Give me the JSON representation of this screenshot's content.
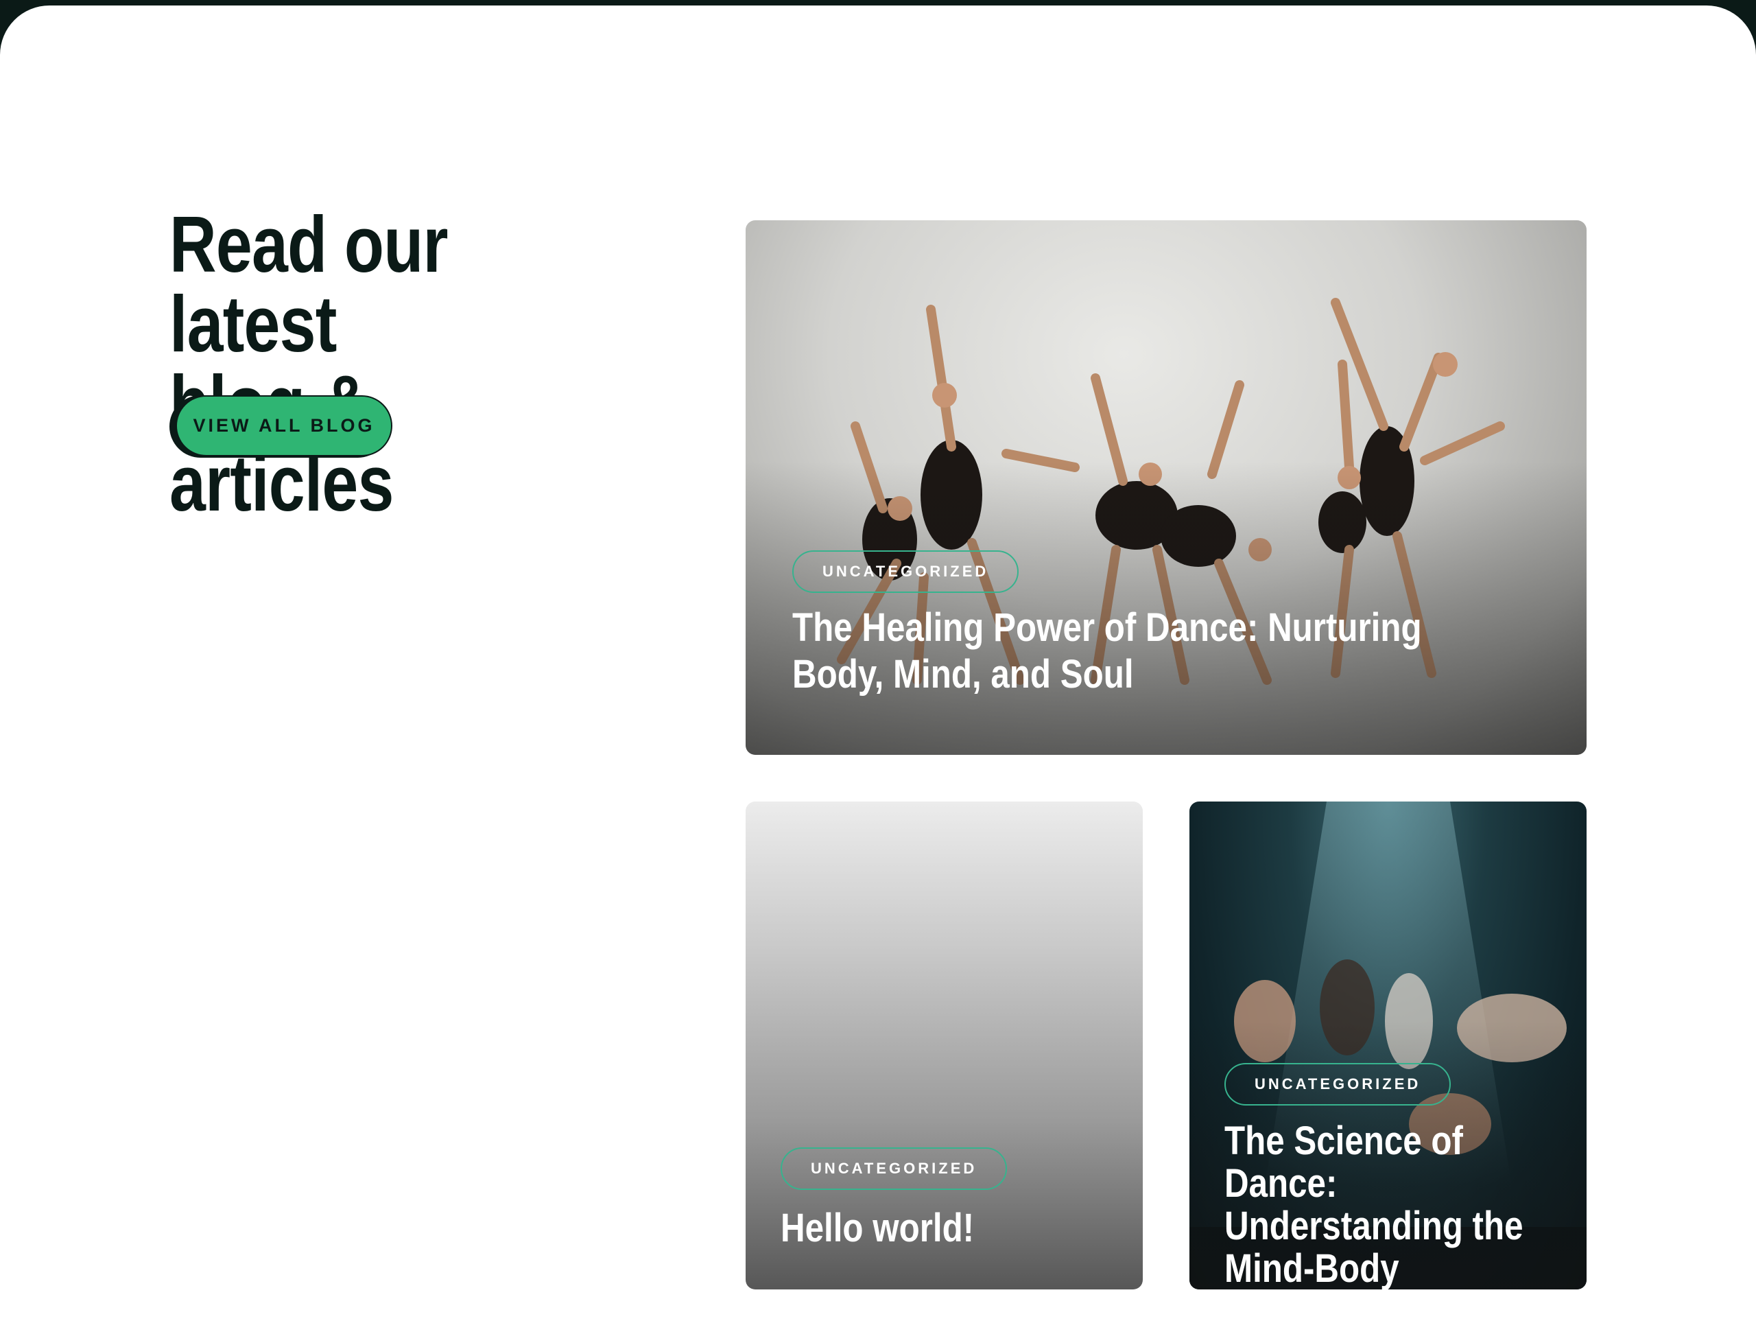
{
  "section": {
    "heading": "Read our latest\nblog & articles",
    "view_all_label": "VIEW ALL BLOG"
  },
  "posts": [
    {
      "category": "UNCATEGORIZED",
      "title": "The Healing Power of Dance: Nurturing Body, Mind, and Soul"
    },
    {
      "category": "UNCATEGORIZED",
      "title": "Hello world!"
    },
    {
      "category": "UNCATEGORIZED",
      "title": "The Science of Dance: Understanding the Mind-Body Connection"
    }
  ],
  "colors": {
    "ink": "#0b1a17",
    "accent": "#2fb573",
    "tag_border": "#37b38e",
    "background": "#ffffff"
  }
}
